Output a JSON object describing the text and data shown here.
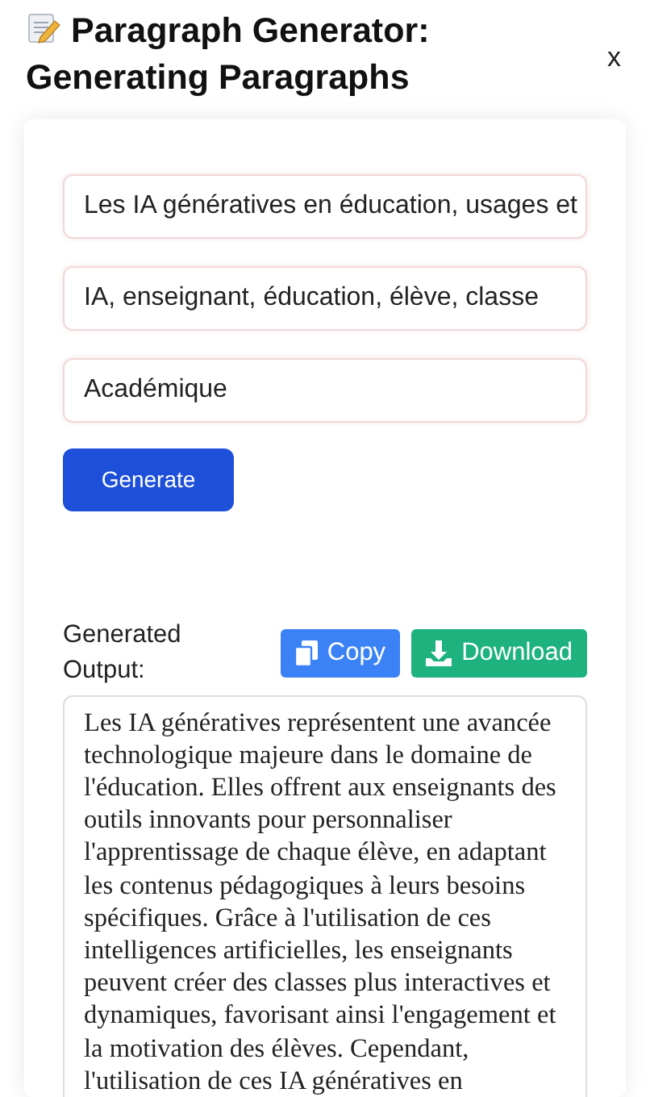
{
  "header": {
    "title_line_1": "Paragraph Generator:",
    "title_line_2": "Generating Paragraphs",
    "close": "x"
  },
  "fields": [
    {
      "value": "Les IA génératives en éducation, usages et"
    },
    {
      "value": "IA, enseignant, éducation, élève, classe"
    },
    {
      "value": "Académique"
    }
  ],
  "generate_button": "Generate",
  "output": {
    "label": "Generated Output:",
    "copy_button": "Copy",
    "download_button": "Download",
    "text": "Les IA génératives représentent une avancée technologique majeure dans le domaine de l'éducation. Elles offrent aux enseignants des outils innovants pour personnaliser l'apprentissage de chaque élève, en adaptant les contenus pédagogiques à leurs besoins spécifiques. Grâce à l'utilisation de ces intelligences artificielles, les enseignants peuvent créer des classes plus interactives et dynamiques, favorisant ainsi l'engagement et la motivation des élèves. Cependant, l'utilisation de ces IA génératives en"
  }
}
